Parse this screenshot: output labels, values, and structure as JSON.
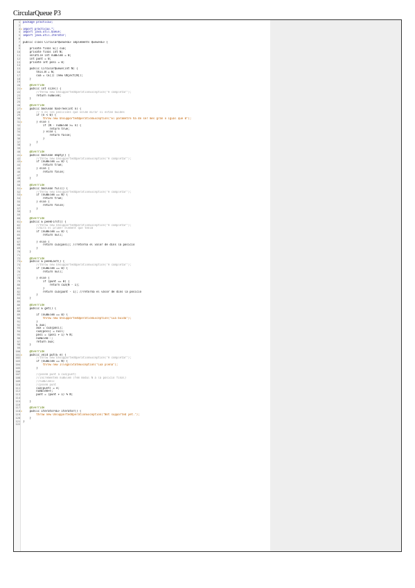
{
  "document": {
    "title": "CircularQueue P3"
  },
  "code_lines": [
    {
      "n": "1",
      "t": "package practica3;"
    },
    {
      "n": "2",
      "t": ""
    },
    {
      "n": "3",
      "t": "import practica3.*;",
      "mark": "warn"
    },
    {
      "n": "4",
      "t": "import java.util.Queue;"
    },
    {
      "n": "5",
      "t": "import java.util.Iterator;"
    },
    {
      "n": "6",
      "t": ""
    },
    {
      "n": "7",
      "t": "public class CircularQueue<E> implements Queue<E> {"
    },
    {
      "n": "8",
      "t": ""
    },
    {
      "n": "9",
      "t": "    private final E[] cua;"
    },
    {
      "n": "10",
      "t": "    private final int N;"
    },
    {
      "n": "11",
      "t": "    volatile int numElem = 0;"
    },
    {
      "n": "12",
      "t": "    int punt = 0;"
    },
    {
      "n": "13",
      "t": "    private int posi = 0;"
    },
    {
      "n": "14",
      "t": ""
    },
    {
      "n": "15",
      "t": "    public CircularQueue(int N) {"
    },
    {
      "n": "16",
      "t": "        this.N = N;"
    },
    {
      "n": "17",
      "t": "        cua = (E[]) (new Object[N]);"
    },
    {
      "n": "18",
      "t": "    }"
    },
    {
      "n": "19",
      "t": ""
    },
    {
      "n": "20",
      "t": "    @Override"
    },
    {
      "n": "21",
      "t": "    public int size() {",
      "mark": "warn"
    },
    {
      "n": "22",
      "t": "        //throw new UnsupportedOperationException(\"A completar\");"
    },
    {
      "n": "23",
      "t": "        return numElem;"
    },
    {
      "n": "24",
      "t": "    }"
    },
    {
      "n": "25",
      "t": ""
    },
    {
      "n": "26",
      "t": "    @Override"
    },
    {
      "n": "27",
      "t": "    public boolean hasFree(int n) {",
      "mark": "warn"
    },
    {
      "n": "28",
      "t": "        // n es les posicions que volem mirar si estan buides"
    },
    {
      "n": "29",
      "t": "        if (n < 0) {"
    },
    {
      "n": "30",
      "t": "            throw new UnsupportedOperationException(\"El parametre ha de ser mes gran o igual que 0\");"
    },
    {
      "n": "31",
      "t": "        } else {",
      "mark": "warn"
    },
    {
      "n": "32",
      "t": "            if (N - numElem >= n) {"
    },
    {
      "n": "33",
      "t": "                return true;"
    },
    {
      "n": "34",
      "t": "            } else {"
    },
    {
      "n": "35",
      "t": "                return false;"
    },
    {
      "n": "36",
      "t": "            }"
    },
    {
      "n": "37",
      "t": "        }"
    },
    {
      "n": "38",
      "t": "    }"
    },
    {
      "n": "39",
      "t": ""
    },
    {
      "n": "40",
      "t": "    @Override"
    },
    {
      "n": "41",
      "t": "    public boolean empty() {",
      "mark": "warn"
    },
    {
      "n": "42",
      "t": "        //throw new UnsupportedOperationException(\"A completar\");"
    },
    {
      "n": "43",
      "t": "        if (numElem == 0) {",
      "mark": "warn"
    },
    {
      "n": "44",
      "t": "            return true;"
    },
    {
      "n": "45",
      "t": "        } else {"
    },
    {
      "n": "46",
      "t": "            return false;"
    },
    {
      "n": "47",
      "t": "        }"
    },
    {
      "n": "48",
      "t": "    }"
    },
    {
      "n": "49",
      "t": ""
    },
    {
      "n": "50",
      "t": "    @Override"
    },
    {
      "n": "51",
      "t": "    public boolean full() {",
      "mark": "warn"
    },
    {
      "n": "52",
      "t": "        //throw new UnsupportedOperationException(\"A completar\");"
    },
    {
      "n": "53",
      "t": "        if (numElem == N) {",
      "mark": "warn"
    },
    {
      "n": "54",
      "t": "            return true;"
    },
    {
      "n": "55",
      "t": "        } else {"
    },
    {
      "n": "56",
      "t": "            return false;"
    },
    {
      "n": "57",
      "t": "        }"
    },
    {
      "n": "58",
      "t": "    }"
    },
    {
      "n": "59",
      "t": ""
    },
    {
      "n": "60",
      "t": "    @Override"
    },
    {
      "n": "61",
      "t": "    public E peekFirst() {",
      "mark": "warn"
    },
    {
      "n": "62",
      "t": "        //throw new UnsupportedOperationException(\"A completar\");"
    },
    {
      "n": "63",
      "t": "        //mira el primer element que tenim"
    },
    {
      "n": "64",
      "t": "        if (numElem == 0) {"
    },
    {
      "n": "65",
      "t": "            return null;"
    },
    {
      "n": "66",
      "t": ""
    },
    {
      "n": "67",
      "t": "        } else {"
    },
    {
      "n": "68",
      "t": "            return cua[posi]; //retorna el valor de dins la posicio"
    },
    {
      "n": "69",
      "t": "        }"
    },
    {
      "n": "70",
      "t": "    }"
    },
    {
      "n": "71",
      "t": ""
    },
    {
      "n": "72",
      "t": "    @Override"
    },
    {
      "n": "73",
      "t": "    public E peekLast() {",
      "mark": "warn"
    },
    {
      "n": "74",
      "t": "        //throw new UnsupportedOperationException(\"A completar\");"
    },
    {
      "n": "75",
      "t": "        if (numElem == 0) {"
    },
    {
      "n": "76",
      "t": "            return null;"
    },
    {
      "n": "77",
      "t": ""
    },
    {
      "n": "78",
      "t": "        } else {"
    },
    {
      "n": "79",
      "t": "            if (punt == 0) {"
    },
    {
      "n": "80",
      "t": "                return cua[N - 1];"
    },
    {
      "n": "81",
      "t": "            }"
    },
    {
      "n": "82",
      "t": "            return cua[punt - 1]; //retorna el valor de dins la posicio"
    },
    {
      "n": "83",
      "t": "        }"
    },
    {
      "n": "84",
      "t": "    }"
    },
    {
      "n": "85",
      "t": ""
    },
    {
      "n": "86",
      "t": "    @Override"
    },
    {
      "n": "87",
      "t": "    public E get() {"
    },
    {
      "n": "88",
      "t": ""
    },
    {
      "n": "89",
      "t": "        if (numElem == 0) {"
    },
    {
      "n": "90",
      "t": "            throw new UnsupportedOperationException(\"Cua buida\");"
    },
    {
      "n": "91",
      "t": "        }"
    },
    {
      "n": "92",
      "t": "        E aux;"
    },
    {
      "n": "93",
      "t": "        aux = cua[posi];"
    },
    {
      "n": "94",
      "t": "        cua[posi] = null;"
    },
    {
      "n": "95",
      "t": "        posi = (posi + 1) % N;"
    },
    {
      "n": "96",
      "t": "        numElem--;"
    },
    {
      "n": "97",
      "t": "        return aux;"
    },
    {
      "n": "98",
      "t": "    }"
    },
    {
      "n": "99",
      "t": ""
    },
    {
      "n": "100",
      "t": "    @Override"
    },
    {
      "n": "101",
      "t": "    public void put(E e) {",
      "mark": "warn"
    },
    {
      "n": "102",
      "t": "        //throw new UnsupportedOperationException(\"A completar\");"
    },
    {
      "n": "103",
      "t": "        if (numElem == N) {"
    },
    {
      "n": "104",
      "t": "            throw new IllegalStateException(\"Cua plena\");"
    },
    {
      "n": "105",
      "t": "        }"
    },
    {
      "n": "106",
      "t": ""
    },
    {
      "n": "107",
      "t": "        //posem punt a cua[punt]"
    },
    {
      "n": "108",
      "t": "        //incrementem numElem (fem modul N a la posicio final)"
    },
    {
      "n": "109",
      "t": "        //numElem++"
    },
    {
      "n": "110",
      "t": "        //posem punt"
    },
    {
      "n": "111",
      "t": "        cua[punt] = e;"
    },
    {
      "n": "112",
      "t": "        numElem++;"
    },
    {
      "n": "113",
      "t": "        punt = (punt + 1) % N;"
    },
    {
      "n": "114",
      "t": ""
    },
    {
      "n": "115",
      "t": "    }"
    },
    {
      "n": "116",
      "t": ""
    },
    {
      "n": "117",
      "t": "    @Override"
    },
    {
      "n": "118",
      "t": "    public Iterator<E> iterator() {",
      "mark": "warn"
    },
    {
      "n": "119",
      "t": "        throw new UnsupportedOperationException(\"Not supported yet.\");"
    },
    {
      "n": "120",
      "t": "    }"
    },
    {
      "n": "121",
      "t": "}"
    },
    {
      "n": "122",
      "t": ""
    }
  ]
}
